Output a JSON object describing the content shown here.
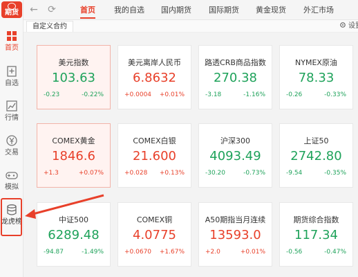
{
  "app": {
    "logo_text": "期货"
  },
  "sidebar": {
    "items": [
      {
        "label": "首页",
        "icon": "home-grid-icon",
        "active": true
      },
      {
        "label": "自选",
        "icon": "favorites-icon",
        "active": false
      },
      {
        "label": "行情",
        "icon": "chart-icon",
        "active": false
      },
      {
        "label": "交易",
        "icon": "yen-trade-icon",
        "active": false
      },
      {
        "label": "模拟",
        "icon": "gamepad-icon",
        "active": false
      },
      {
        "label": "龙虎榜",
        "icon": "database-icon",
        "active": false
      }
    ]
  },
  "topbar": {
    "tabs": [
      {
        "label": "首页",
        "active": true
      },
      {
        "label": "我的自选",
        "active": false
      },
      {
        "label": "国内期货",
        "active": false
      },
      {
        "label": "国际期货",
        "active": false
      },
      {
        "label": "黄金现货",
        "active": false
      },
      {
        "label": "外汇市场",
        "active": false
      }
    ]
  },
  "subbar": {
    "tab_label": "自定义合约",
    "settings_label": "设置"
  },
  "colors": {
    "accent": "#e8402a",
    "up": "#e8402a",
    "down": "#1ea25a"
  },
  "cards": [
    {
      "name": "美元指数",
      "price": "103.63",
      "change": "-0.23",
      "percent": "-0.22%",
      "trend": "down",
      "selected": true
    },
    {
      "name": "美元离岸人民币",
      "price": "6.8632",
      "change": "+0.0004",
      "percent": "+0.01%",
      "trend": "up",
      "selected": false
    },
    {
      "name": "路透CRB商品指数",
      "price": "270.38",
      "change": "-3.18",
      "percent": "-1.16%",
      "trend": "down",
      "selected": false
    },
    {
      "name": "NYMEX原油",
      "price": "78.33",
      "change": "-0.26",
      "percent": "-0.33%",
      "trend": "down",
      "selected": false
    },
    {
      "name": "COMEX黄金",
      "price": "1846.6",
      "change": "+1.3",
      "percent": "+0.07%",
      "trend": "up",
      "selected": true
    },
    {
      "name": "COMEX白银",
      "price": "21.600",
      "change": "+0.028",
      "percent": "+0.13%",
      "trend": "up",
      "selected": false
    },
    {
      "name": "沪深300",
      "price": "4093.49",
      "change": "-30.20",
      "percent": "-0.73%",
      "trend": "down",
      "selected": false
    },
    {
      "name": "上证50",
      "price": "2742.80",
      "change": "-9.54",
      "percent": "-0.35%",
      "trend": "down",
      "selected": false
    },
    {
      "name": "中证500",
      "price": "6289.48",
      "change": "-94.87",
      "percent": "-1.49%",
      "trend": "down",
      "selected": false
    },
    {
      "name": "COMEX铜",
      "price": "4.0775",
      "change": "+0.0670",
      "percent": "+1.67%",
      "trend": "up",
      "selected": false
    },
    {
      "name": "A50期指当月连续",
      "price": "13593.0",
      "change": "+2.0",
      "percent": "+0.01%",
      "trend": "up",
      "selected": false
    },
    {
      "name": "期货综合指数",
      "price": "117.34",
      "change": "-0.56",
      "percent": "-0.47%",
      "trend": "down",
      "selected": false
    }
  ]
}
